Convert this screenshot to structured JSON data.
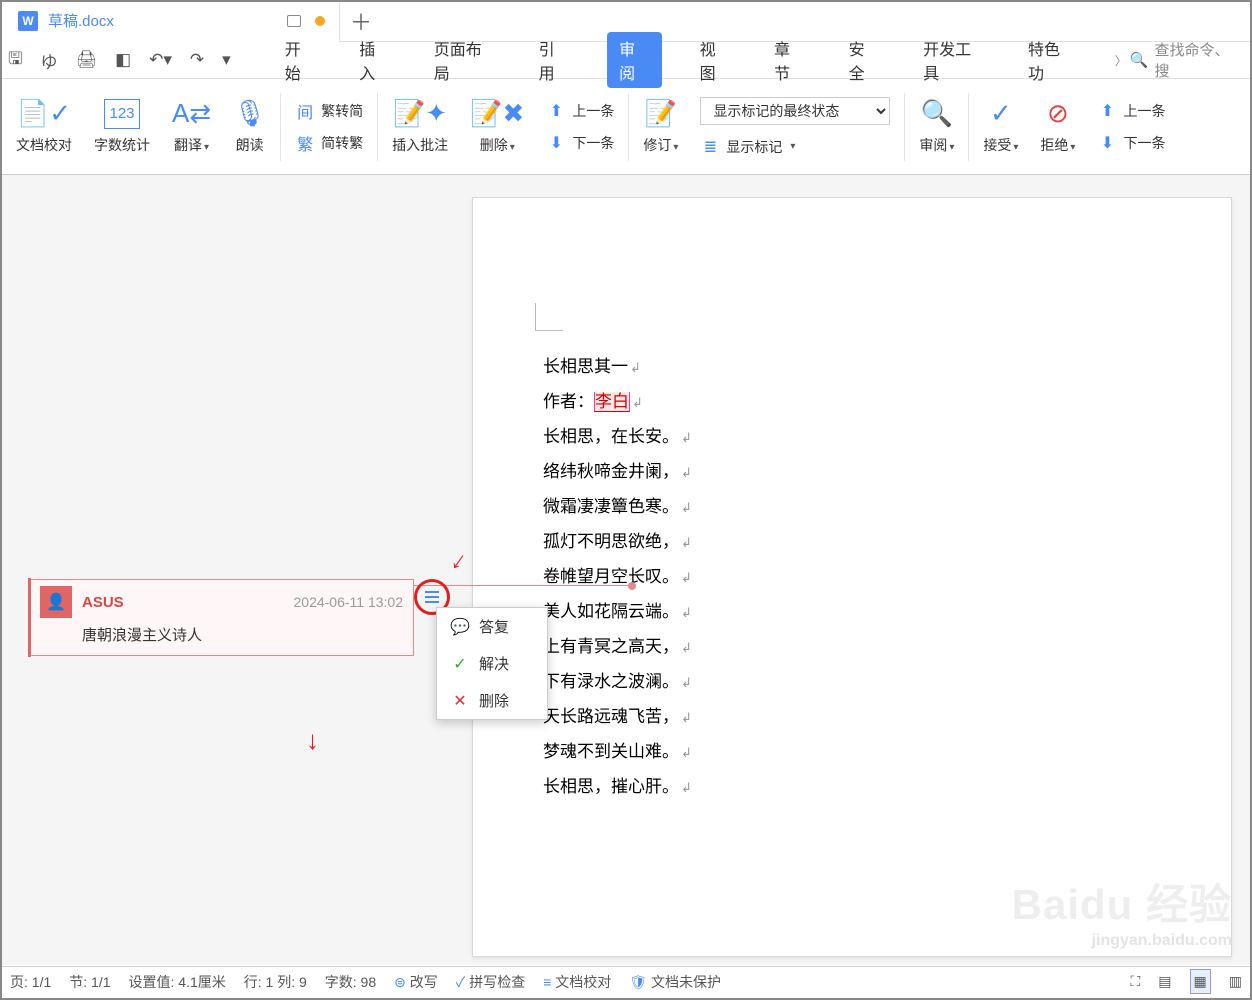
{
  "title": {
    "doc_name": "草稿.docx",
    "doc_icon": "W"
  },
  "menutabs": {
    "start": "开始",
    "insert": "插入",
    "layout": "页面布局",
    "ref": "引用",
    "review": "审阅",
    "view": "视图",
    "chapter": "章节",
    "security": "安全",
    "devtools": "开发工具",
    "special": "特色功"
  },
  "search_placeholder": "查找命令、搜",
  "ribbon": {
    "proof": "文档校对",
    "wordcount": "字数统计",
    "translate": "翻译",
    "read": "朗读",
    "trad1": "繁转简",
    "trad2": "简转繁",
    "trad_char1": "间",
    "trad_char2": "繁",
    "insert_comment": "插入批注",
    "delete": "删除",
    "prev": "上一条",
    "next": "下一条",
    "revision": "修订",
    "display_mode": "显示标记的最终状态",
    "show_marks": "显示标记",
    "review_btn": "审阅",
    "accept": "接受",
    "reject": "拒绝",
    "prev2": "上一条",
    "next2": "下一条"
  },
  "comment": {
    "user": "ASUS",
    "time": "2024-06-11 13:02",
    "text": "唐朝浪漫主义诗人"
  },
  "ctx": {
    "reply": "答复",
    "resolve": "解决",
    "delete": "删除"
  },
  "poem": {
    "title": "长相思其一",
    "author_label": "作者：",
    "author": "李白",
    "l1": "长相思，在长安。",
    "l2": "络纬秋啼金井阑，",
    "l3": "微霜凄凄簟色寒。",
    "l4": "孤灯不明思欲绝，",
    "l5": "卷帷望月空长叹。",
    "l6": "美人如花隔云端。",
    "l7": "上有青冥之高天，",
    "l8": "下有渌水之波澜。",
    "l9": "天长路远魂飞苦，",
    "l10": "梦魂不到关山难。",
    "l11": "长相思，摧心肝。"
  },
  "status": {
    "page": "页: 1/1",
    "section": "节: 1/1",
    "pos": "设置值: 4.1厘米",
    "line": "行: 1  列: 9",
    "wc": "字数: 98",
    "rewrite": "改写",
    "spell": "拼写检查",
    "doccheck": "文档校对",
    "protect": "文档未保护"
  },
  "watermark": {
    "brand": "Baidu 经验",
    "url": "jingyan.baidu.com"
  }
}
